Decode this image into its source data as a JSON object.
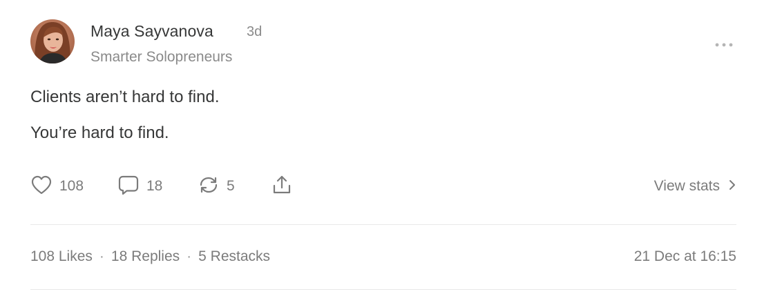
{
  "author": {
    "name": "Maya Sayvanova",
    "time_ago": "3d",
    "publication": "Smarter Solopreneurs"
  },
  "post": {
    "lines": [
      "Clients aren’t hard to find.",
      "You’re hard to find."
    ]
  },
  "actions": {
    "likes": "108",
    "replies": "18",
    "restacks": "5",
    "view_stats": "View stats"
  },
  "stats": {
    "likes": "108 Likes",
    "replies": "18 Replies",
    "restacks": "5 Restacks",
    "separator": "·",
    "date": "21 Dec at 16:15"
  },
  "icons": {
    "more": "more-horizontal-icon",
    "like": "heart-icon",
    "reply": "comment-bubble-icon",
    "restack": "restack-arrows-icon",
    "share": "share-upload-icon",
    "chevron": "chevron-right-icon"
  },
  "colors": {
    "text": "#363737",
    "muted": "#8a8a8a",
    "icon": "#7b7b7b",
    "divider": "#e8e8e8"
  }
}
